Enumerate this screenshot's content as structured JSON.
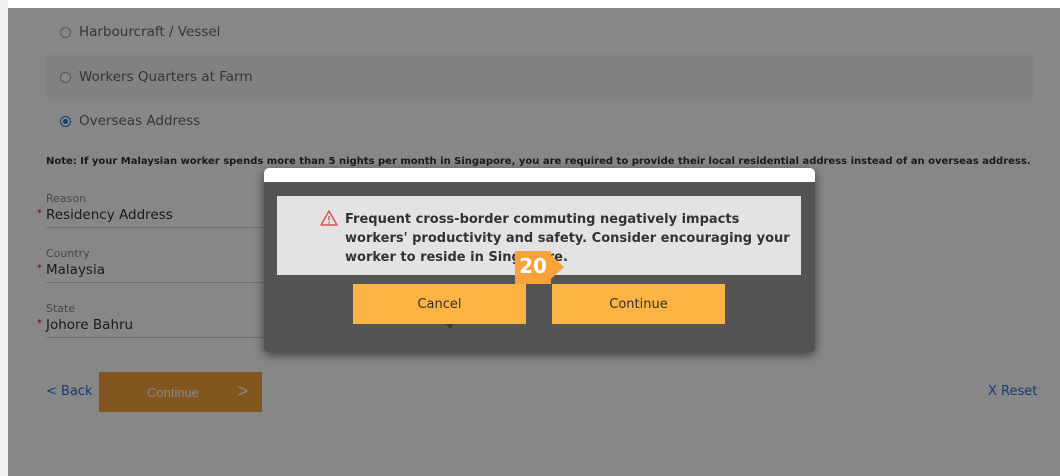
{
  "address_types": [
    {
      "label": "Harbourcraft / Vessel",
      "checked": false
    },
    {
      "label": "Workers Quarters at Farm",
      "checked": false
    },
    {
      "label": "Overseas Address",
      "checked": true
    }
  ],
  "note": "Note: If your Malaysian worker spends more than 5 nights per month in Singapore, you are required to provide their local residential address instead of an overseas address.",
  "fields": {
    "reason": {
      "label": "Reason",
      "value": "Residency Address"
    },
    "country": {
      "label": "Country",
      "value": "Malaysia"
    },
    "state": {
      "label": "State",
      "value": "Johore Bahru"
    }
  },
  "required_mark": "*",
  "nav": {
    "back_label": "< Back",
    "continue_label": "Continue",
    "continue_chevron": ">",
    "reset_label": "X Reset"
  },
  "modal": {
    "icon": "warning-triangle-icon",
    "message": "Frequent cross-border commuting negatively impacts workers' productivity and safety. Consider encouraging your worker to reside in Singapore.",
    "cancel_label": "Cancel",
    "continue_label": "Continue"
  },
  "step_badge": "20",
  "colors": {
    "accent": "#f7a23b",
    "button": "#fbb343",
    "link": "#2c6fd1",
    "warning": "#d9534f"
  }
}
